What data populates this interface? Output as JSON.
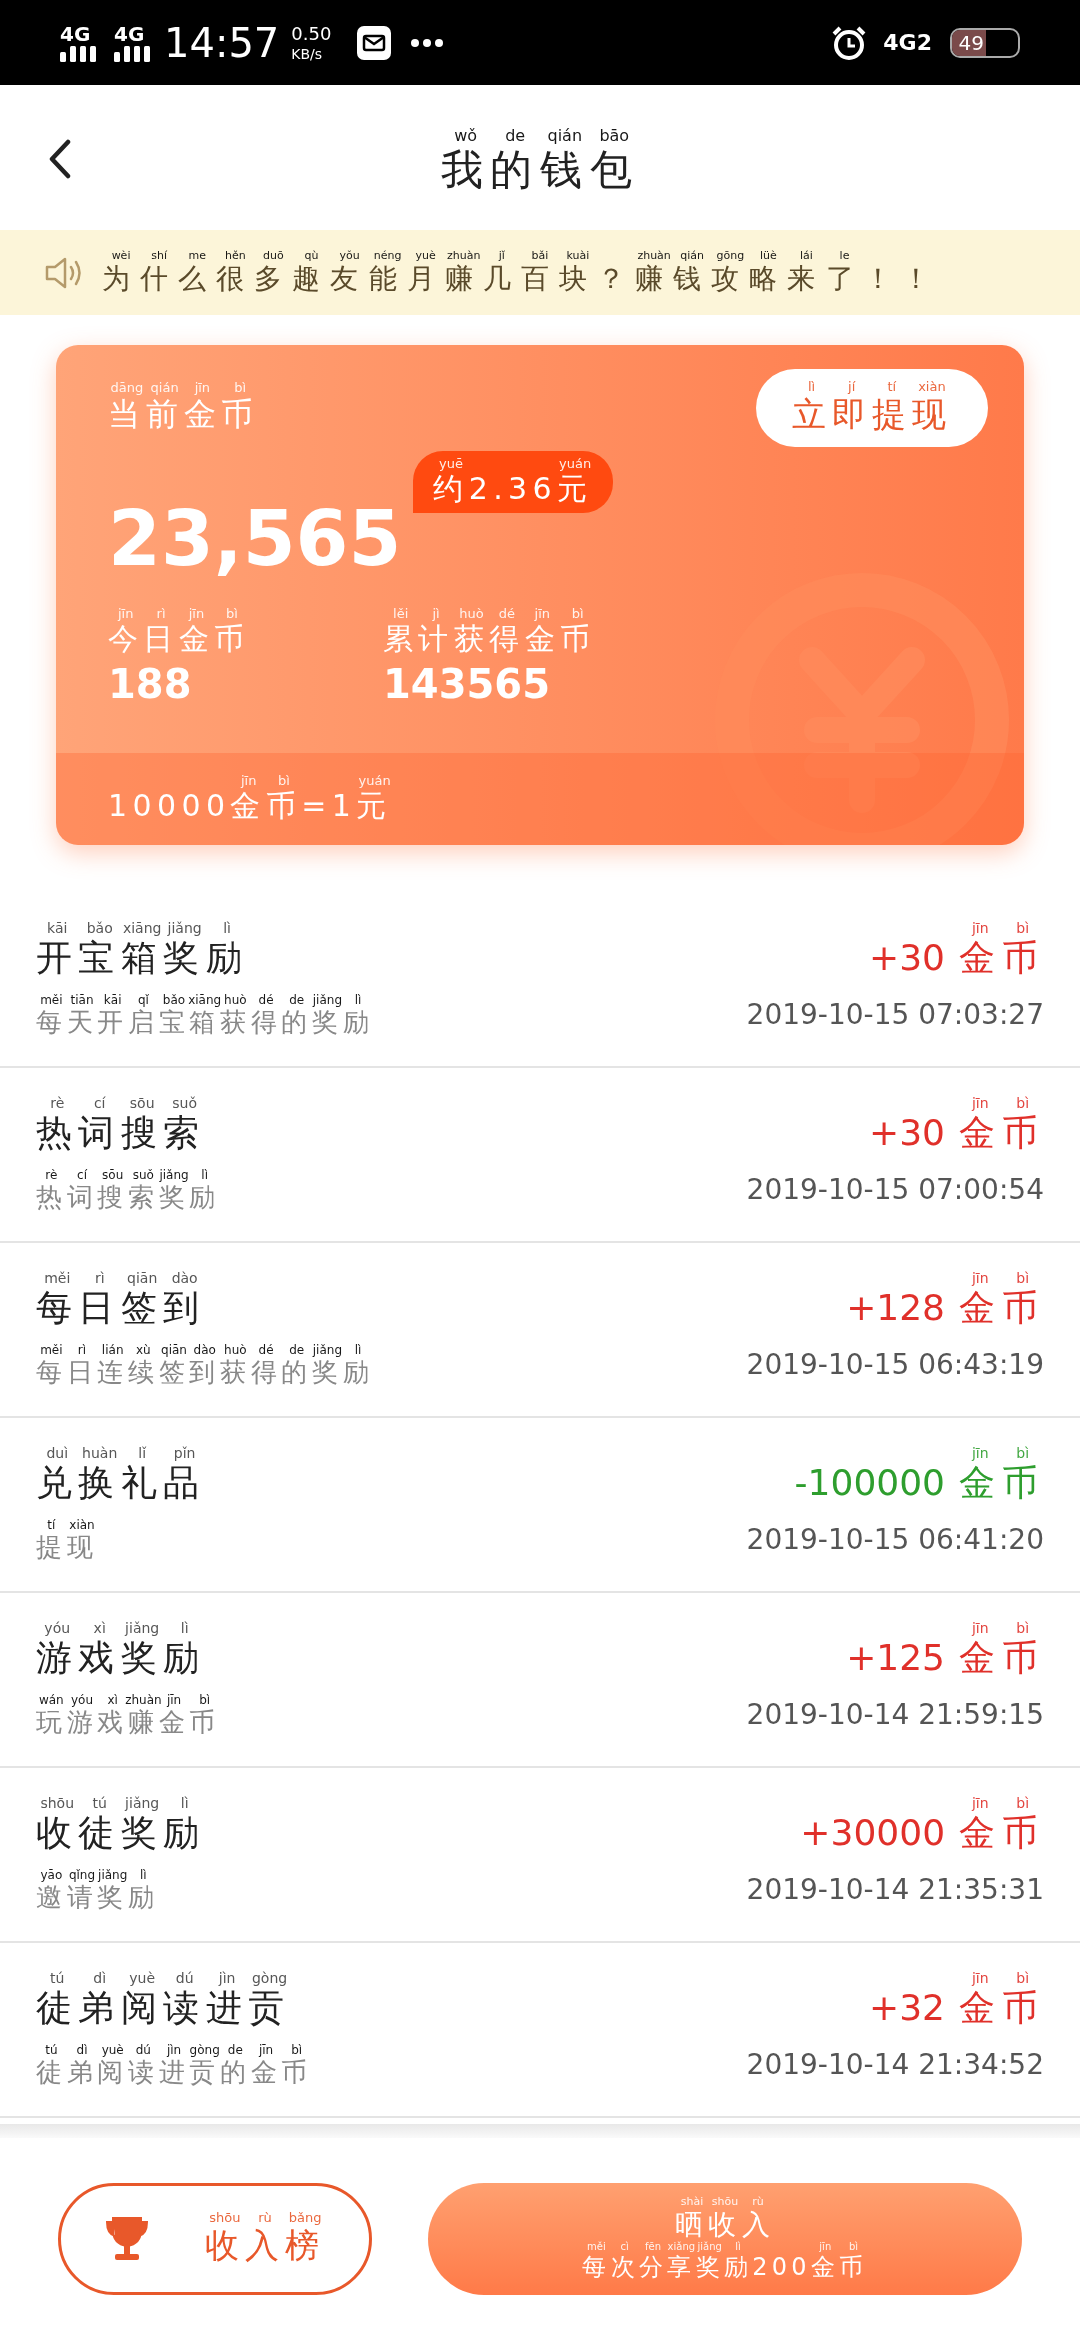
{
  "status_bar": {
    "network_1": "4G",
    "network_2": "4G",
    "time": "14:57",
    "speed": "0.50",
    "speed_unit": "KB/s",
    "network_3": "4G2",
    "battery": "49"
  },
  "header": {
    "title": {
      "text": "我的钱包",
      "pinyin": "wǒ de qián bāo"
    }
  },
  "notice": {
    "text": "为什么很多趣友能月赚几百块？赚钱攻略来了！！",
    "pinyin": "wèi shí me hěn duō qù yǒu néng yuè zhuàn jǐ bǎi kuài zhuàn qián gōng lüè lái le"
  },
  "wallet_card": {
    "label": {
      "text": "当前金币",
      "pinyin": "dāng qián jīn bì"
    },
    "withdraw_button": {
      "text": "立即提现",
      "pinyin": "lì jí tí xiàn"
    },
    "balance": "23,565",
    "equivalent": {
      "text": "约2.36元",
      "pinyin": "yuē yuán"
    },
    "stats": [
      {
        "label": {
          "text": "今日金币",
          "pinyin": "jīn rì jīn bì"
        },
        "value": "188"
      },
      {
        "label": {
          "text": "累计获得金币",
          "pinyin": "lěi jì huò dé jīn bì"
        },
        "value": "143565"
      }
    ],
    "rate": {
      "text": "10000金币=1元",
      "pinyin": "jīn bì yuán"
    }
  },
  "transactions": [
    {
      "title": {
        "text": "开宝箱奖励",
        "pinyin": "kāi bǎo xiāng jiǎng lì"
      },
      "description": {
        "text": "每天开启宝箱获得的奖励",
        "pinyin": "měi tiān kāi qǐ bǎo xiāng huò dé de jiǎng lì"
      },
      "amount": "+30",
      "unit": {
        "text": "金币",
        "pinyin": "jīn bì"
      },
      "color": "#e0302a",
      "time": "2019-10-15 07:03:27"
    },
    {
      "title": {
        "text": "热词搜索",
        "pinyin": "rè cí sōu suǒ"
      },
      "description": {
        "text": "热词搜索奖励",
        "pinyin": "rè cí sōu suǒ jiǎng lì"
      },
      "amount": "+30",
      "unit": {
        "text": "金币",
        "pinyin": "jīn bì"
      },
      "color": "#e0302a",
      "time": "2019-10-15 07:00:54"
    },
    {
      "title": {
        "text": "每日签到",
        "pinyin": "měi rì qiān dào"
      },
      "description": {
        "text": "每日连续签到获得的奖励",
        "pinyin": "měi rì lián xù qiān dào huò dé de jiǎng lì"
      },
      "amount": "+128",
      "unit": {
        "text": "金币",
        "pinyin": "jīn bì"
      },
      "color": "#e0302a",
      "time": "2019-10-15 06:43:19"
    },
    {
      "title": {
        "text": "兑换礼品",
        "pinyin": "duì huàn lǐ pǐn"
      },
      "description": {
        "text": "提现",
        "pinyin": "tí xiàn"
      },
      "amount": "-100000",
      "unit": {
        "text": "金币",
        "pinyin": "jīn bì"
      },
      "color": "#2e9e2e",
      "time": "2019-10-15 06:41:20"
    },
    {
      "title": {
        "text": "游戏奖励",
        "pinyin": "yóu xì jiǎng lì"
      },
      "description": {
        "text": "玩游戏赚金币",
        "pinyin": "wán yóu xì zhuàn jīn bì"
      },
      "amount": "+125",
      "unit": {
        "text": "金币",
        "pinyin": "jīn bì"
      },
      "color": "#e0302a",
      "time": "2019-10-14 21:59:15"
    },
    {
      "title": {
        "text": "收徒奖励",
        "pinyin": "shōu tú jiǎng lì"
      },
      "description": {
        "text": "邀请奖励",
        "pinyin": "yāo qǐng jiǎng lì"
      },
      "amount": "+30000",
      "unit": {
        "text": "金币",
        "pinyin": "jīn bì"
      },
      "color": "#e0302a",
      "time": "2019-10-14 21:35:31"
    },
    {
      "title": {
        "text": "徒弟阅读进贡",
        "pinyin": "tú dì yuè dú jìn gòng"
      },
      "description": {
        "text": "徒弟阅读进贡的金币",
        "pinyin": "tú dì yuè dú jìn gòng de jīn bì"
      },
      "amount": "+32",
      "unit": {
        "text": "金币",
        "pinyin": "jīn bì"
      },
      "color": "#e0302a",
      "time": "2019-10-14 21:34:52"
    }
  ],
  "bottom_bar": {
    "ranking_button": {
      "text": "收入榜",
      "pinyin": "shōu rù bǎng"
    },
    "share_button": {
      "title": {
        "text": "晒收入",
        "pinyin": "shài shōu rù"
      },
      "subtitle": {
        "text": "每次分享奖励200金币",
        "pinyin": "měi cì fēn xiǎng jiǎng lì jīn bì"
      }
    }
  }
}
